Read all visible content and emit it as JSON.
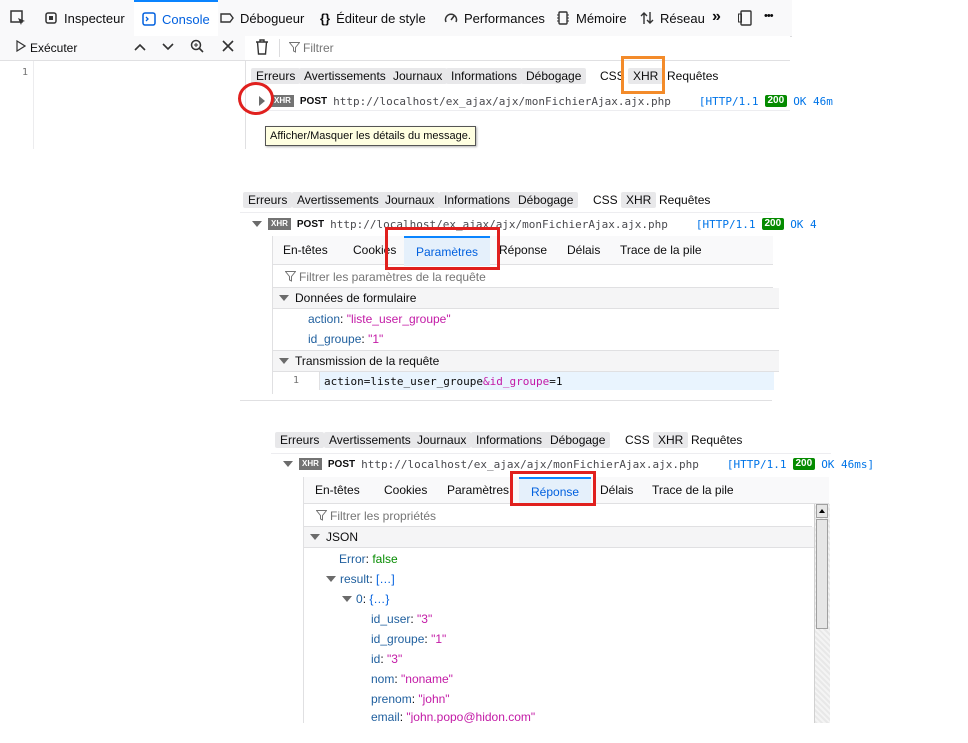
{
  "toolbar": {
    "tabs": [
      {
        "label": "Inspecteur",
        "icon": "inspector-icon"
      },
      {
        "label": "Console",
        "icon": "console-icon",
        "selected": true
      },
      {
        "label": "Débogueur",
        "icon": "debugger-icon"
      },
      {
        "label": "Éditeur de style",
        "icon": "style-editor-icon"
      },
      {
        "label": "Performances",
        "icon": "performance-icon"
      },
      {
        "label": "Mémoire",
        "icon": "memory-icon"
      },
      {
        "label": "Réseau",
        "icon": "network-icon"
      }
    ],
    "more_label": "»",
    "menu_label": "•••"
  },
  "console": {
    "execute_label": "Exécuter",
    "line_number": "1",
    "filter_placeholder": "Filtrer"
  },
  "filters": [
    "Erreurs",
    "Avertissements",
    "Journaux",
    "Informations",
    "Débogage",
    "CSS",
    "XHR",
    "Requêtes"
  ],
  "request": {
    "badge": "XHR",
    "method": "POST",
    "url": "http://localhost/ex_ajax/ajx/monFichierAjax.ajx.php",
    "http": "[HTTP/1.1",
    "status": "200",
    "ok_short": "OK 46m",
    "ok_short2": "OK 4",
    "ok_full": "OK 46ms]"
  },
  "tooltip": "Afficher/Masquer les détails du message.",
  "detail_tabs": [
    "En-têtes",
    "Cookies",
    "Paramètres",
    "Réponse",
    "Délais",
    "Trace de la pile"
  ],
  "params_panel": {
    "filter_placeholder": "Filtrer les paramètres de la requête",
    "form_section": "Données de formulaire",
    "fields": [
      {
        "key": "action",
        "value": "\"liste_user_groupe\""
      },
      {
        "key": "id_groupe",
        "value": "\"1\""
      }
    ],
    "transmission_section": "Transmission de la requête",
    "payload_line": "1",
    "payload": {
      "key1": "action",
      "eq1": "=",
      "val1": "liste_user_groupe",
      "amp": "&",
      "key2": "id_groupe",
      "eq2": "=",
      "val2": "1"
    }
  },
  "response_panel": {
    "filter_placeholder": "Filtrer les propriétés",
    "json_label": "JSON",
    "error_key": "Error",
    "error_val": "false",
    "result_key": "result",
    "result_val": "[…]",
    "item_key": "0",
    "item_val": "{…}",
    "props": [
      {
        "key": "id_user",
        "value": "\"3\""
      },
      {
        "key": "id_groupe",
        "value": "\"1\""
      },
      {
        "key": "id",
        "value": "\"3\""
      },
      {
        "key": "nom",
        "value": "\"noname\""
      },
      {
        "key": "prenom",
        "value": "\"john\""
      },
      {
        "key": "email",
        "value": "\"john.popo@hidon.com\""
      }
    ]
  },
  "colors": {
    "accent": "#0a84ff",
    "highlight_red": "#e0201e",
    "highlight_orange": "#f38b2a",
    "status_green": "#058b00"
  }
}
